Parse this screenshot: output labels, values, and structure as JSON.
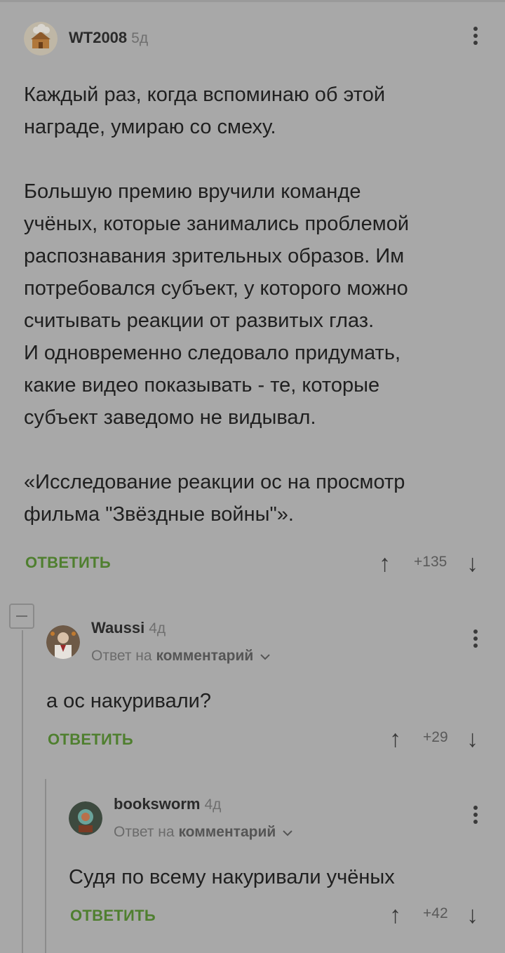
{
  "comments": [
    {
      "username": "WT2008",
      "time": "5д",
      "paragraphs": [
        [
          "Каждый раз, когда вспоминаю об этой",
          "награде, умираю со смеху."
        ],
        [
          "Большую премию вручили команде",
          "учёных, которые занимались проблемой",
          "распознавания зрительных образов. Им",
          "потребовался субъект, у которого можно",
          "считывать реакции от развитых глаз.",
          "И одновременно следовало придумать,",
          "какие видео показывать - те, которые",
          "субъект заведомо не видывал."
        ],
        [
          "«Исследование реакции ос на просмотр",
          "фильма \"Звёздные войны\"»."
        ]
      ],
      "reply_label": "ОТВЕТИТЬ",
      "score": "+135"
    },
    {
      "username": "Waussi",
      "time": "4д",
      "reply_to_prefix": "Ответ на",
      "reply_to_target": "комментарий",
      "text": "а ос накуривали?",
      "reply_label": "ОТВЕТИТЬ",
      "score": "+29"
    },
    {
      "username": "booksworm",
      "time": "4д",
      "reply_to_prefix": "Ответ на",
      "reply_to_target": "комментарий",
      "text": "Судя по всему накуривали учёных",
      "reply_label": "ОТВЕТИТЬ",
      "score": "+42"
    }
  ],
  "icons": {
    "upvote": "arrow-up-icon",
    "downvote": "arrow-down-icon",
    "menu": "kebab-menu-icon",
    "collapse": "collapse-thread-icon",
    "chevron": "chevron-down-icon"
  },
  "colors": {
    "background": "#a8a8a8",
    "reply_button": "#4f7f2f",
    "text": "#1f1f1f"
  }
}
